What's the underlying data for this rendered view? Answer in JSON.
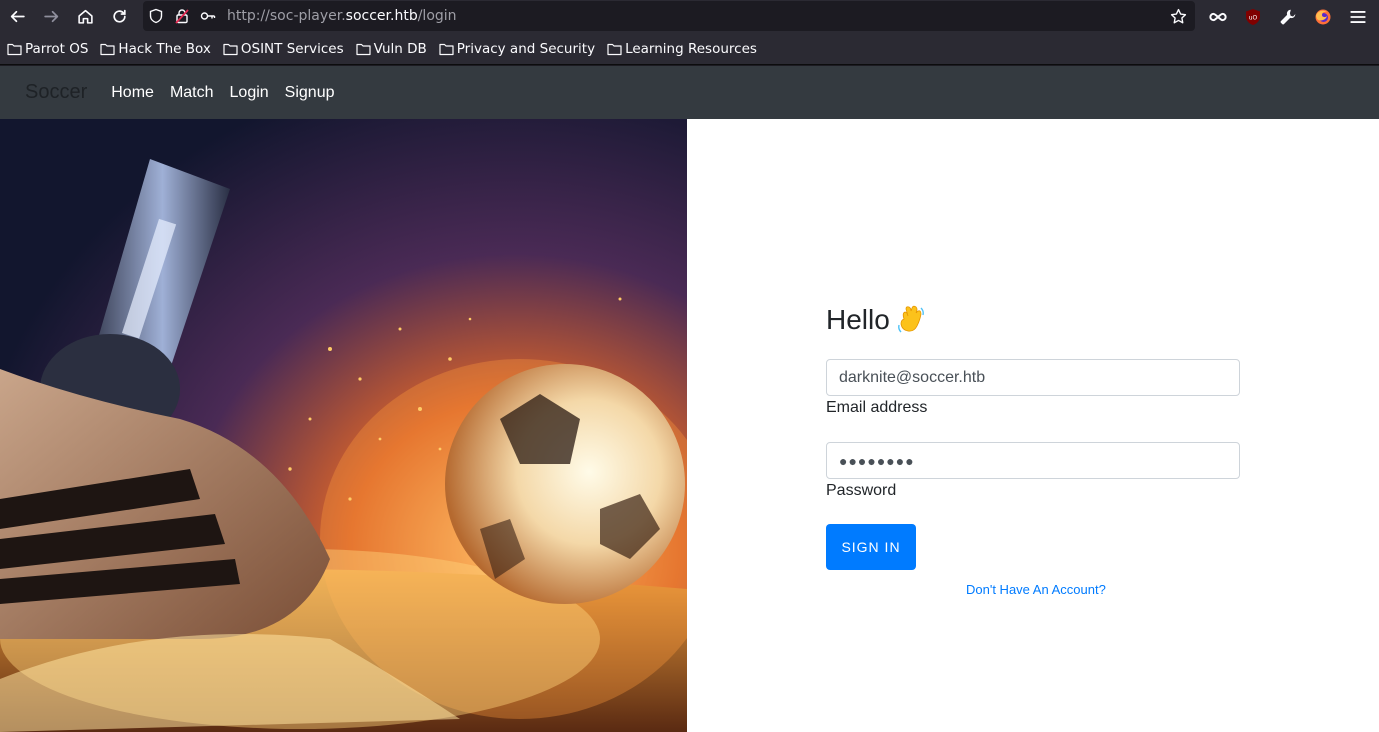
{
  "browser": {
    "url_prefix": "http://soc-player.",
    "url_host": "soccer.htb",
    "url_path": "/login",
    "icons": [
      "back-arrow-icon",
      "forward-arrow-icon",
      "home-icon",
      "reload-icon",
      "shield-icon",
      "lock-warning-icon",
      "key-icon",
      "star-icon",
      "infinity-icon",
      "ublock-icon",
      "wrench-icon",
      "firefox-icon",
      "hamburger-menu-icon"
    ]
  },
  "bookmarks": [
    {
      "label": "Parrot OS"
    },
    {
      "label": "Hack The Box"
    },
    {
      "label": "OSINT Services"
    },
    {
      "label": "Vuln DB"
    },
    {
      "label": "Privacy and Security"
    },
    {
      "label": "Learning Resources"
    }
  ],
  "navbar": {
    "brand": "Soccer",
    "links": [
      "Home",
      "Match",
      "Login",
      "Signup"
    ]
  },
  "login": {
    "greeting": "Hello",
    "email_value": "darknite@soccer.htb",
    "email_label": "Email address",
    "password_value": "●●●●●●●●",
    "password_label": "Password",
    "submit_label": "SIGN IN",
    "signup_link": "Don't Have An Account?"
  },
  "colors": {
    "navbar_bg": "#343a40",
    "primary": "#007bff",
    "browser_bg": "#2b2a33"
  }
}
